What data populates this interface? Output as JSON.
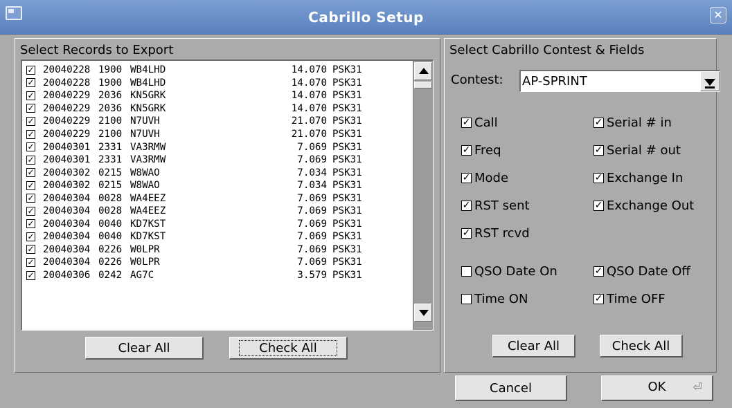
{
  "window": {
    "title": "Cabrillo Setup",
    "close_glyph": "✕"
  },
  "left": {
    "title": "Select Records to Export",
    "records": [
      {
        "checked": true,
        "date": "20040228",
        "time": "1900",
        "call": "WB4LHD",
        "freq": "14.070",
        "mode": "PSK31"
      },
      {
        "checked": true,
        "date": "20040228",
        "time": "1900",
        "call": "WB4LHD",
        "freq": "14.070",
        "mode": "PSK31"
      },
      {
        "checked": true,
        "date": "20040229",
        "time": "2036",
        "call": "KN5GRK",
        "freq": "14.070",
        "mode": "PSK31"
      },
      {
        "checked": true,
        "date": "20040229",
        "time": "2036",
        "call": "KN5GRK",
        "freq": "14.070",
        "mode": "PSK31"
      },
      {
        "checked": true,
        "date": "20040229",
        "time": "2100",
        "call": "N7UVH",
        "freq": "21.070",
        "mode": "PSK31"
      },
      {
        "checked": true,
        "date": "20040229",
        "time": "2100",
        "call": "N7UVH",
        "freq": "21.070",
        "mode": "PSK31"
      },
      {
        "checked": true,
        "date": "20040301",
        "time": "2331",
        "call": "VA3RMW",
        "freq": "7.069",
        "mode": "PSK31"
      },
      {
        "checked": true,
        "date": "20040301",
        "time": "2331",
        "call": "VA3RMW",
        "freq": "7.069",
        "mode": "PSK31"
      },
      {
        "checked": true,
        "date": "20040302",
        "time": "0215",
        "call": "W8WAO",
        "freq": "7.034",
        "mode": "PSK31"
      },
      {
        "checked": true,
        "date": "20040302",
        "time": "0215",
        "call": "W8WAO",
        "freq": "7.034",
        "mode": "PSK31"
      },
      {
        "checked": true,
        "date": "20040304",
        "time": "0028",
        "call": "WA4EEZ",
        "freq": "7.069",
        "mode": "PSK31"
      },
      {
        "checked": true,
        "date": "20040304",
        "time": "0028",
        "call": "WA4EEZ",
        "freq": "7.069",
        "mode": "PSK31"
      },
      {
        "checked": true,
        "date": "20040304",
        "time": "0040",
        "call": "KD7KST",
        "freq": "7.069",
        "mode": "PSK31"
      },
      {
        "checked": true,
        "date": "20040304",
        "time": "0040",
        "call": "KD7KST",
        "freq": "7.069",
        "mode": "PSK31"
      },
      {
        "checked": true,
        "date": "20040304",
        "time": "0226",
        "call": "W0LPR",
        "freq": "7.069",
        "mode": "PSK31"
      },
      {
        "checked": true,
        "date": "20040304",
        "time": "0226",
        "call": "W0LPR",
        "freq": "7.069",
        "mode": "PSK31"
      },
      {
        "checked": true,
        "date": "20040306",
        "time": "0242",
        "call": "AG7C",
        "freq": "3.579",
        "mode": "PSK31"
      }
    ],
    "clear_all": "Clear All",
    "check_all": "Check All"
  },
  "right": {
    "title": "Select Cabrillo Contest & Fields",
    "contest_label": "Contest:",
    "contest_value": "AP-SPRINT",
    "fields": [
      {
        "label": "Call",
        "checked": true
      },
      {
        "label": "Serial # in",
        "checked": true
      },
      {
        "label": "Freq",
        "checked": true
      },
      {
        "label": "Serial # out",
        "checked": true
      },
      {
        "label": "Mode",
        "checked": true
      },
      {
        "label": "Exchange In",
        "checked": true
      },
      {
        "label": "RST sent",
        "checked": true
      },
      {
        "label": "Exchange Out",
        "checked": true
      },
      {
        "label": "RST rcvd",
        "checked": true
      },
      {
        "label": "QSO Date On",
        "checked": false
      },
      {
        "label": "QSO Date Off",
        "checked": true
      },
      {
        "label": "Time ON",
        "checked": false
      },
      {
        "label": "Time OFF",
        "checked": true
      }
    ],
    "clear_all": "Clear All",
    "check_all": "Check All"
  },
  "footer": {
    "cancel": "Cancel",
    "ok": "OK",
    "ok_glyph": "⏎"
  },
  "colors": {
    "titlebar": "#6a8fc8",
    "background": "#ababab",
    "button": "#e4e4e4"
  }
}
